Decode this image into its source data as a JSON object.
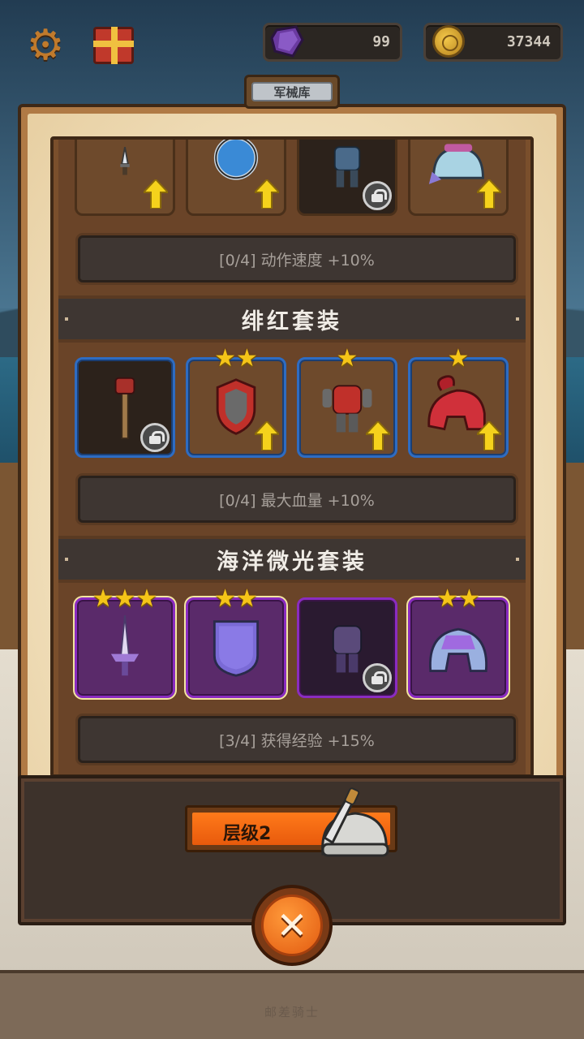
{
  "hud": {
    "gems": "99",
    "gold": "37344",
    "gear_icon": "gear-icon",
    "gift_icon": "gift-icon"
  },
  "armory": {
    "title": "军械库",
    "sets": [
      {
        "name": "",
        "bonus": "[0/4] 动作速度 +10%",
        "items": [
          {
            "icon": "dagger-icon",
            "stars": 0,
            "locked": false,
            "upgradable": true
          },
          {
            "icon": "round-shield-icon",
            "stars": 0,
            "locked": false,
            "upgradable": true
          },
          {
            "icon": "armor-icon",
            "stars": 0,
            "locked": true,
            "upgradable": false
          },
          {
            "icon": "helmet-icon",
            "stars": 0,
            "locked": false,
            "upgradable": true
          }
        ]
      },
      {
        "name": "绯红套装",
        "bonus": "[0/4] 最大血量 +10%",
        "items": [
          {
            "icon": "mace-icon",
            "stars": 0,
            "locked": true,
            "upgradable": false
          },
          {
            "icon": "red-shield-icon",
            "stars": 2,
            "locked": false,
            "upgradable": true
          },
          {
            "icon": "red-armor-icon",
            "stars": 1,
            "locked": false,
            "upgradable": true
          },
          {
            "icon": "red-helmet-icon",
            "stars": 1,
            "locked": false,
            "upgradable": true
          }
        ]
      },
      {
        "name": "海洋微光套装",
        "bonus": "[3/4] 获得经验 +15%",
        "items": [
          {
            "icon": "crystal-sword-icon",
            "stars": 3,
            "locked": false,
            "upgradable": false
          },
          {
            "icon": "hex-shield-icon",
            "stars": 2,
            "locked": false,
            "upgradable": false
          },
          {
            "icon": "purple-armor-icon",
            "stars": 0,
            "locked": true,
            "upgradable": false
          },
          {
            "icon": "crystal-helmet-icon",
            "stars": 2,
            "locked": false,
            "upgradable": false
          }
        ]
      }
    ],
    "level_label": "层级2",
    "close_label": "✕"
  },
  "footer": "邮差骑士",
  "colors": {
    "accent_orange": "#e85a0c",
    "blue_rarity": "#2e6cc2",
    "purple_rarity": "#8a2cc0",
    "star": "#f5c518"
  }
}
